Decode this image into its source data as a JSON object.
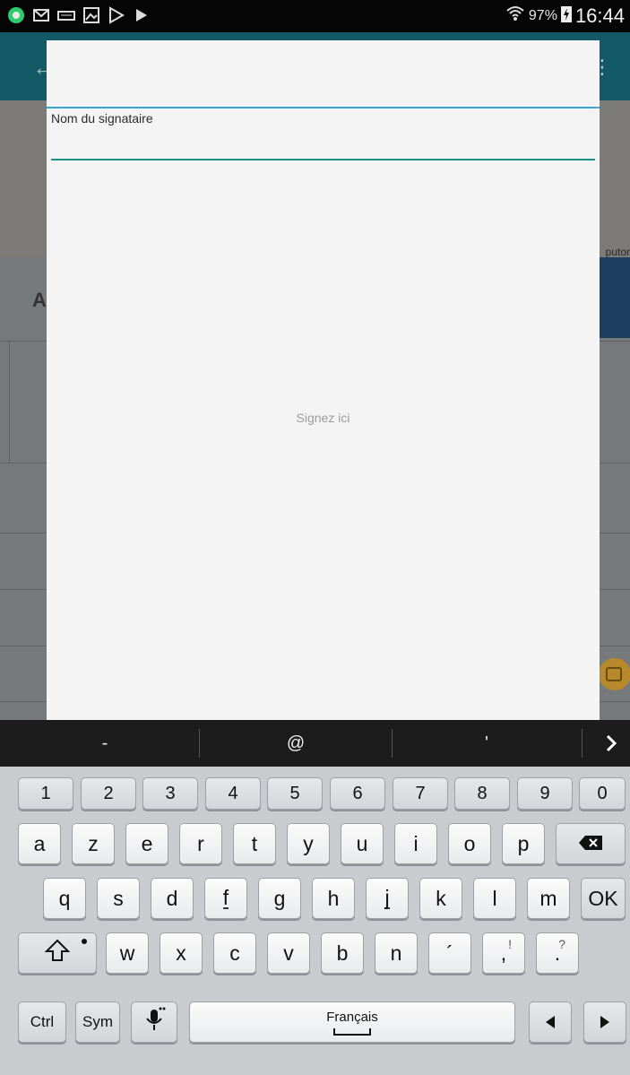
{
  "status_bar": {
    "battery": "97%",
    "time": "16:44",
    "icons": [
      "android-notification-icon",
      "message-icon",
      "keyboard-icon",
      "image-icon",
      "play-store-icon",
      "play-icon",
      "wifi-icon",
      "battery-charging-icon"
    ]
  },
  "background_app": {
    "banner_text": "putor",
    "title_partial": "Al"
  },
  "dialog": {
    "name_label": "Nom du signataire",
    "name_value": "",
    "sign_hint": "Signez ici"
  },
  "suggestions": [
    "-",
    "@",
    "'"
  ],
  "keyboard": {
    "row_numbers": [
      "1",
      "2",
      "3",
      "4",
      "5",
      "6",
      "7",
      "8",
      "9",
      "0"
    ],
    "row1": [
      "a",
      "z",
      "e",
      "r",
      "t",
      "y",
      "u",
      "i",
      "o",
      "p"
    ],
    "row2": [
      "q",
      "s",
      "d",
      "f",
      "g",
      "h",
      "j",
      "k",
      "l",
      "m"
    ],
    "ok_label": "OK",
    "row3": [
      "w",
      "x",
      "c",
      "v",
      "b",
      "n"
    ],
    "punct1": "´",
    "punct2_main": ",",
    "punct2_alt": "!",
    "punct3_main": ".",
    "punct3_alt": "?",
    "ctrl_label": "Ctrl",
    "sym_label": "Sym",
    "space_label": "Français"
  },
  "colors": {
    "dialog_top_line": "#39a6d0",
    "input_underline": "#14918a",
    "toolbar": "#135a66"
  }
}
